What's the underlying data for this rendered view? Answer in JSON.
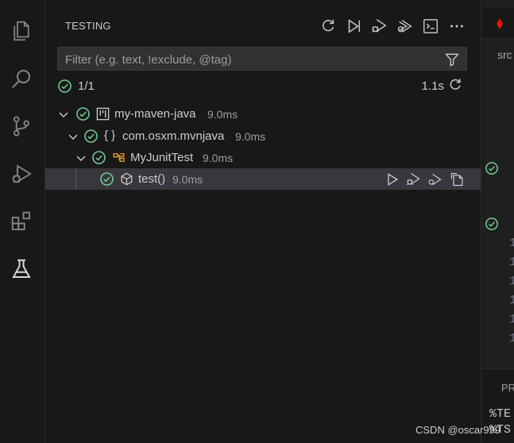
{
  "activity_bar": {
    "items": [
      {
        "name": "explorer-icon"
      },
      {
        "name": "search-icon"
      },
      {
        "name": "source-control-icon"
      },
      {
        "name": "run-debug-icon"
      },
      {
        "name": "extensions-icon"
      },
      {
        "name": "testing-icon",
        "active": true
      }
    ]
  },
  "testing": {
    "title": "TESTING",
    "header_actions": [
      "refresh-tests",
      "run-tests",
      "debug-tests",
      "run-with-coverage",
      "show-output",
      "more-actions"
    ],
    "filter": {
      "placeholder": "Filter (e.g. text, !exclude, @tag)",
      "value": ""
    },
    "summary": {
      "count": "1/1",
      "duration": "1.1s"
    },
    "tree": [
      {
        "level": 0,
        "kind": "project",
        "label": "my-maven-java",
        "duration": "9.0ms",
        "status": "passed"
      },
      {
        "level": 1,
        "kind_text": "{ }",
        "kind": "package",
        "label": "com.osxm.mvnjava",
        "duration": "9.0ms",
        "status": "passed"
      },
      {
        "level": 2,
        "kind": "class",
        "label": "MyJunitTest",
        "duration": "9.0ms",
        "status": "passed"
      },
      {
        "level": 3,
        "kind": "method",
        "label": "test()",
        "duration": "9.0ms",
        "status": "passed",
        "selected": true
      }
    ]
  },
  "editor": {
    "breadcrumb": "src",
    "line_numbers": [
      "1",
      "1",
      "1",
      "1",
      "1",
      "1"
    ],
    "panel_title": "PR",
    "terminal_lines": [
      "%TE",
      "%TS"
    ]
  },
  "watermark": "CSDN @oscar999",
  "colors": {
    "passed": "#73c991",
    "accent": "#0078d4",
    "class_icon": "#ee9d28",
    "background": "#181818"
  }
}
